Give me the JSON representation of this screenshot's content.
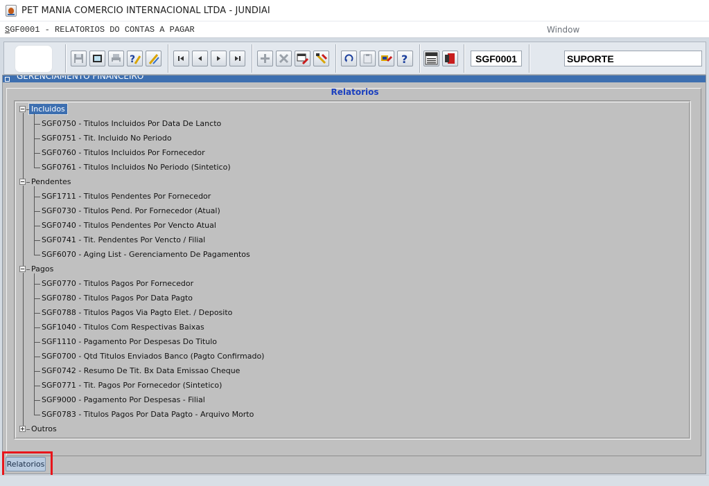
{
  "window": {
    "title": "PET MANIA COMERCIO INTERNACIONAL LTDA - JUNDIAI"
  },
  "menu": {
    "form_title_first": "S",
    "form_title_rest": "GF0001 - RELATORIOS DO CONTAS A PAGAR",
    "window_label": "Window"
  },
  "toolbar": {
    "form_code": "SGF0001",
    "user": "SUPORTE",
    "buttons": [
      "save-icon",
      "print-preview-icon",
      "printer-icon",
      "help-query-icon",
      "edit-query-icon",
      "first-record-icon",
      "previous-record-icon",
      "next-record-icon",
      "last-record-icon",
      "insert-record-icon",
      "delete-record-icon",
      "execute-query-icon",
      "clear-icon",
      "undo-icon",
      "clipboard-icon",
      "tools-icon",
      "help-icon",
      "menu-icon",
      "exit-icon"
    ]
  },
  "panel": {
    "header": "GERENCIAMENTO FINANCEIRO",
    "frame_title": "Relatorios"
  },
  "tree": {
    "groups": [
      {
        "label": "Incluidos",
        "expanded": true,
        "selected": true,
        "items": [
          "SGF0750 - Titulos Incluidos Por Data De Lancto",
          "SGF0751 - Tit. Incluido No Periodo",
          "SGF0760 - Titulos Incluidos Por Fornecedor",
          "SGF0761 - Titulos Incluidos No Periodo (Sintetico)"
        ]
      },
      {
        "label": "Pendentes",
        "expanded": true,
        "selected": false,
        "items": [
          "SGF1711 - Titulos Pendentes Por Fornecedor",
          "SGF0730 - Titulos Pend. Por Fornecedor (Atual)",
          "SGF0740 - Titulos Pendentes Por Vencto Atual",
          "SGF0741 - Tit. Pendentes Por Vencto / Filial",
          "SGF6070 - Aging List - Gerenciamento De Pagamentos"
        ]
      },
      {
        "label": "Pagos",
        "expanded": true,
        "selected": false,
        "items": [
          "SGF0770 - Titulos Pagos Por Fornecedor",
          "SGF0780 - Titulos Pagos Por Data Pagto",
          "SGF0788 - Titulos Pagos Via Pagto Elet. / Deposito",
          "SGF1040 - Titulos Com Respectivas Baixas",
          "SGF1110 - Pagamento Por Despesas Do Titulo",
          "SGF0700 - Qtd Titulos Enviados Banco (Pagto Confirmado)",
          "SGF0742 - Resumo De Tit. Bx Data Emissao Cheque",
          "SGF0771 - Tit. Pagos Por Fornecedor (Sintetico)",
          "SGF9000 - Pagamento Por Despesas - Filial",
          "SGF0783 - Titulos Pagos Por Data Pagto - Arquivo Morto"
        ]
      },
      {
        "label": "Outros",
        "expanded": false,
        "selected": false,
        "items": []
      }
    ]
  },
  "bottom_tabs": {
    "active": "Relatorios"
  },
  "colors": {
    "accent_blue": "#3d6fb0",
    "frame_title": "#1a3fbf",
    "highlight": "#e8151b",
    "panel_bg": "#c0c0c0"
  }
}
